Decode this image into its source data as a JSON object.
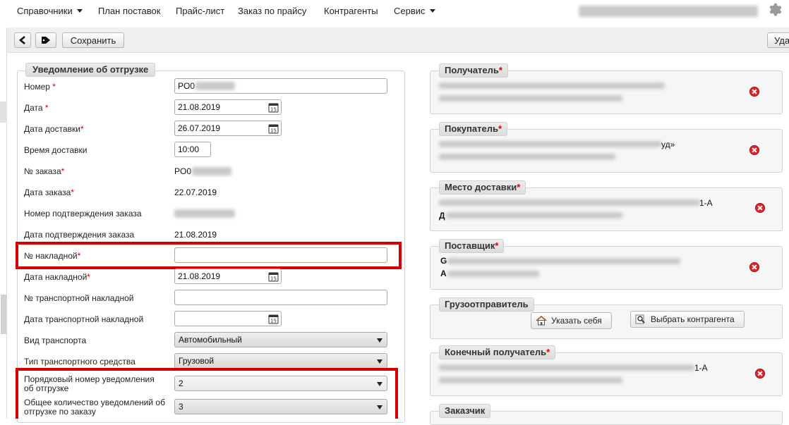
{
  "nav": {
    "items": [
      "Справочники",
      "План поставок",
      "Прайс-лист",
      "Заказ по прайсу",
      "Контрагенты",
      "Сервис"
    ]
  },
  "toolbar": {
    "save_label": "Сохранить",
    "delete_label": "Уда"
  },
  "form": {
    "legend": "Уведомление об отгрузке",
    "number": {
      "label": "Номер",
      "value": "PO0"
    },
    "date": {
      "label": "Дата",
      "value": "21.08.2019"
    },
    "delivery_date": {
      "label": "Дата доставки",
      "value": "26.07.2019"
    },
    "delivery_time": {
      "label": "Время доставки",
      "value": "10:00"
    },
    "order_number": {
      "label": "№ заказа",
      "value": "PO0"
    },
    "order_date": {
      "label": "Дата заказа",
      "value": "22.07.2019"
    },
    "order_confirm_number": {
      "label": "Номер подтверждения заказа",
      "value": ""
    },
    "order_confirm_date": {
      "label": "Дата подтверждения заказа",
      "value": "21.08.2019"
    },
    "invoice_number": {
      "label": "№ накладной",
      "value": ""
    },
    "invoice_date": {
      "label": "Дата накладной",
      "value": "21.08.2019"
    },
    "transport_invoice_number": {
      "label": "№ транспортной накладной",
      "value": ""
    },
    "transport_invoice_date": {
      "label": "Дата транспортной накладной",
      "value": ""
    },
    "transport_type": {
      "label": "Вид транспорта",
      "value": "Автомобильный"
    },
    "vehicle_type": {
      "label": "Тип транспортного средства",
      "value": "Грузовой"
    },
    "notice_seq": {
      "label_line1": "Порядковый номер уведомления",
      "label_line2": "об отгрузке",
      "value": "2"
    },
    "notice_total": {
      "label_line1": "Общее количество уведомлений об",
      "label_line2": "отгрузке по заказу",
      "value": "3"
    },
    "required_mark": "*"
  },
  "right": {
    "recipient": {
      "label": "Получатель"
    },
    "buyer": {
      "label": "Покупатель",
      "tail": "уд»"
    },
    "delivery_place": {
      "label": "Место доставки",
      "tail": "1-А",
      "tail2": "Д"
    },
    "supplier": {
      "label": "Поставщик",
      "line1_start": "G",
      "line2_start": "А"
    },
    "shipper": {
      "label": "Грузоотправитель",
      "btn_self": "Указать себя",
      "btn_choose": "Выбрать контрагента"
    },
    "consignee": {
      "label": "Конечный получатель",
      "tail": "1-А"
    },
    "customer": {
      "label": "Заказчик"
    }
  },
  "colors": {
    "highlight": "#d20000",
    "required": "#d40000",
    "delete_icon": "#e0262a"
  },
  "icons": [
    "chevron-down-icon",
    "gear-icon",
    "back-arrow-icon",
    "tag-icon",
    "calendar-icon",
    "delete-icon",
    "home-icon",
    "search-icon"
  ]
}
